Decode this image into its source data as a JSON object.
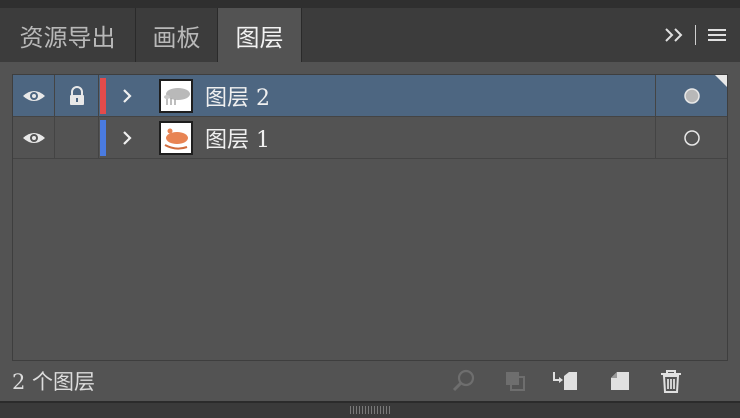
{
  "tabs": [
    {
      "label": "资源导出",
      "active": false
    },
    {
      "label": "画板",
      "active": false
    },
    {
      "label": "图层",
      "active": true
    }
  ],
  "tab_tools": {
    "expand_icon": "double-chevron-right-icon",
    "menu_icon": "hamburger-menu-icon"
  },
  "layers": [
    {
      "name": "图层 2",
      "visible": true,
      "locked": true,
      "color": "#e34b4b",
      "selected": true,
      "thumbnail": "gray-shape"
    },
    {
      "name": "图层 1",
      "visible": true,
      "locked": false,
      "color": "#4a7be0",
      "selected": false,
      "thumbnail": "orange-shape"
    }
  ],
  "footer": {
    "count_text": "2 个图层",
    "buttons": [
      "locate-object-icon",
      "make-clipping-mask-icon",
      "move-to-layer-icon",
      "new-layer-icon",
      "delete-layer-icon"
    ]
  },
  "colors": {
    "selected_row": "#4d6681",
    "panel_bg": "#535353",
    "tab_bg": "#3c3c3c"
  }
}
